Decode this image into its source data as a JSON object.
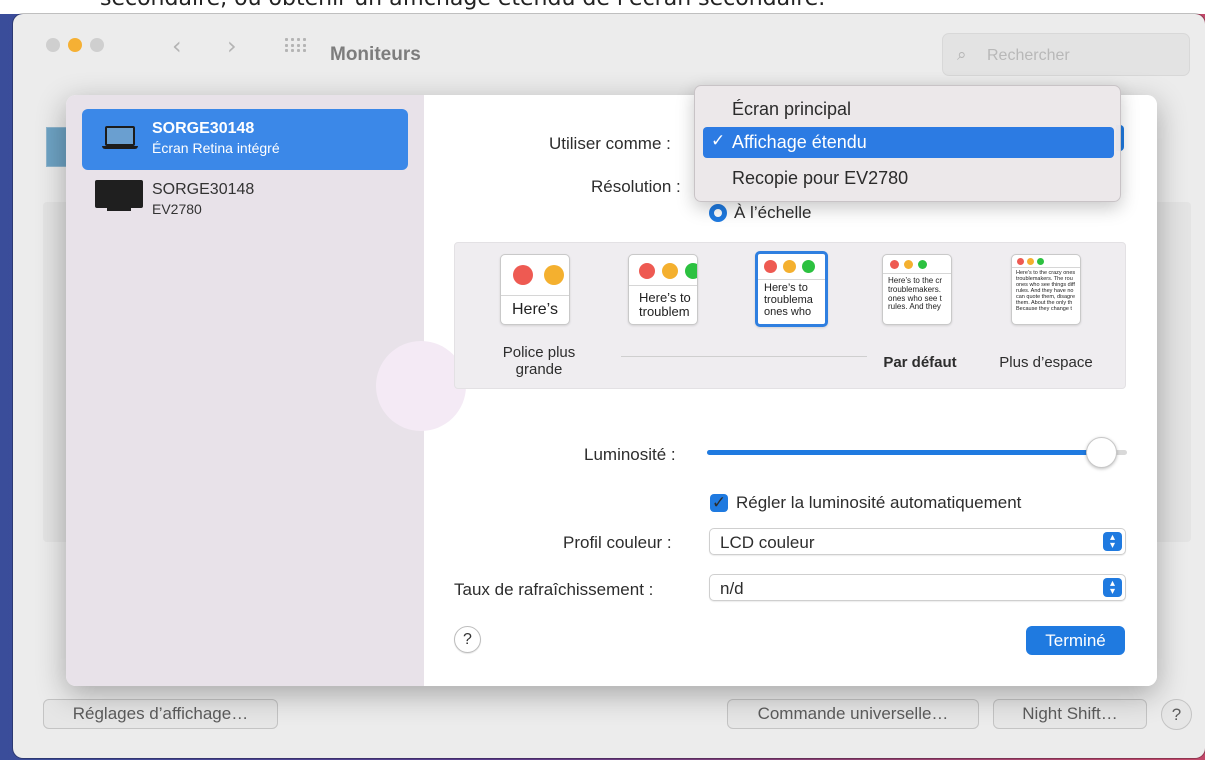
{
  "top_strip_text": "secondaire, ou obtenir un affichage étendu de l'écran secondaire.",
  "window": {
    "title": "Moniteurs",
    "search_placeholder": "Rechercher",
    "bottom_buttons": {
      "display_settings": "Réglages d’affichage…",
      "universal_control": "Commande universelle…",
      "night_shift": "Night Shift…",
      "help": "?"
    }
  },
  "sidebar": {
    "items": [
      {
        "name": "SORGE30148",
        "subtitle": "Écran Retina intégré",
        "selected": true
      },
      {
        "name": "SORGE30148",
        "subtitle": "EV2780",
        "selected": false
      }
    ]
  },
  "settings": {
    "use_as_label": "Utiliser comme :",
    "resolution_label": "Résolution :",
    "scaled_option": "À l’échelle",
    "scale_options": [
      {
        "label": "Police plus grande",
        "preview": "Here’s"
      },
      {
        "label": "",
        "preview": "Here’s to troublem"
      },
      {
        "label": "",
        "preview": "Here’s to troublema ones who"
      },
      {
        "label": "Par défaut",
        "preview": "Here’s to the cr troublemakers. ones who see t rules. And they"
      },
      {
        "label": "Plus d’espace",
        "preview": "Here's to the crazy ones troublemakers. The rou ones who see things diff rules. And they have no can quote them, disagre them. About the only th Because they change t"
      }
    ],
    "brightness_label": "Luminosité :",
    "brightness_level": 0.95,
    "auto_brightness_label": "Régler la luminosité automatiquement",
    "auto_brightness_checked": true,
    "color_profile_label": "Profil couleur :",
    "color_profile_value": "LCD couleur",
    "refresh_rate_label": "Taux de rafraîchissement :",
    "refresh_rate_value": "n/d",
    "help_label": "?",
    "done_label": "Terminé"
  },
  "dropdown": {
    "items": [
      {
        "label": "Écran principal",
        "selected": false
      },
      {
        "label": "Affichage étendu",
        "selected": true
      },
      {
        "label": "Recopie pour EV2780",
        "selected": false
      }
    ],
    "check_mark": "✓"
  },
  "colors": {
    "accent": "#1f7ae0",
    "selection": "#3b88e8",
    "sidebar_bg": "#e8e2e9",
    "traffic_yellow": "#f5b034"
  }
}
